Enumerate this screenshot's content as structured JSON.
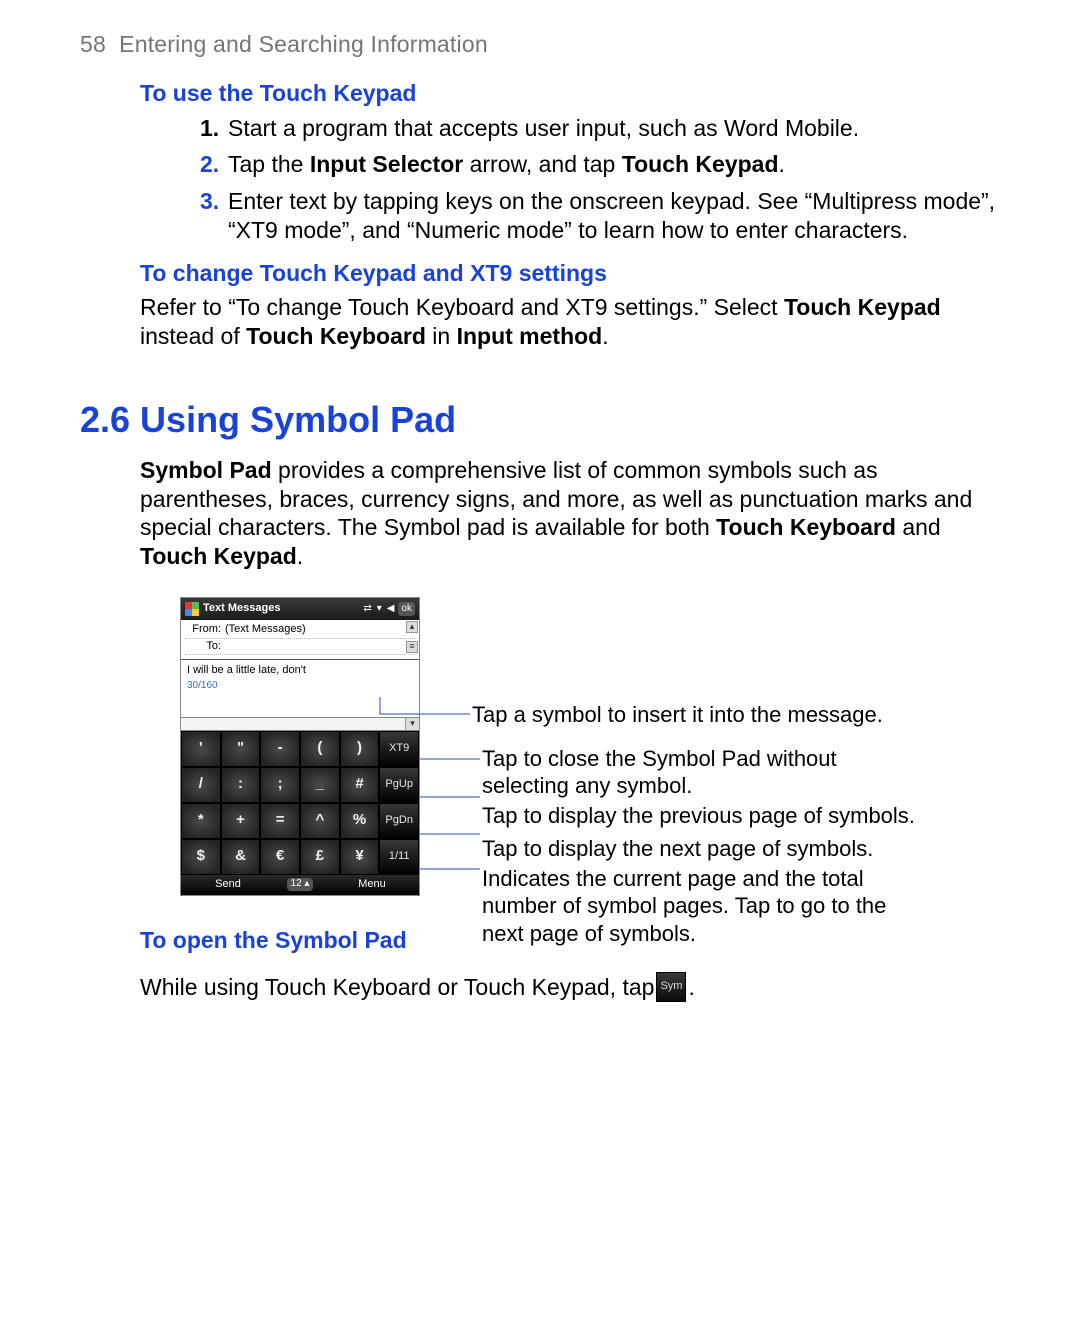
{
  "header": {
    "page_number": "58",
    "chapter_title": "Entering and Searching Information"
  },
  "sections": {
    "use_touch_keypad": {
      "heading": "To use the Touch Keypad",
      "items": [
        {
          "num": "1.",
          "prefix": "",
          "text": "Start a program that accepts user input, such as Word Mobile."
        },
        {
          "num": "2.",
          "prefix": "Tap the ",
          "bold1": "Input Selector",
          "mid": " arrow, and tap ",
          "bold2": "Touch Keypad",
          "suffix": "."
        },
        {
          "num": "3.",
          "text": "Enter text by tapping keys on the onscreen keypad. See “Multipress mode”, “XT9 mode”, and “Numeric mode” to learn how to enter characters."
        }
      ]
    },
    "change_settings": {
      "heading": "To change Touch Keypad and XT9 settings",
      "para_pre": "Refer to “To change Touch Keyboard and XT9 settings.” Select ",
      "bold1": "Touch Keypad",
      "mid": " instead of ",
      "bold2": "Touch Keyboard",
      "mid2": " in ",
      "bold3": "Input method",
      "suffix": "."
    },
    "symbol_pad": {
      "heading": "2.6  Using Symbol Pad",
      "para_bold1": "Symbol Pad",
      "para_text1": " provides a comprehensive list of common symbols such as parentheses, braces, currency signs, and more, as well as punctuation marks and special characters. The Symbol pad is available for both ",
      "para_bold2": "Touch Keyboard",
      "para_mid": " and ",
      "para_bold3": "Touch Keypad",
      "para_suffix": "."
    },
    "open_symbol": {
      "heading": "To open the Symbol Pad",
      "text_pre": "While using Touch Keyboard or Touch Keypad, tap ",
      "text_post": ".",
      "key_label": "Sym"
    }
  },
  "phone_ui": {
    "titlebar": "Text Messages",
    "ok": "ok",
    "from_label": "From:",
    "from_value": "(Text Messages)",
    "to_label": "To:",
    "to_value": "",
    "message_text": "I will be a little late, don't",
    "counter": "30/160",
    "side_keys": [
      "XT9",
      "PgUp",
      "PgDn",
      "1/11"
    ],
    "keypad": [
      [
        "'",
        "\"",
        "-",
        "(",
        ")"
      ],
      [
        "/",
        ":",
        ";",
        "_",
        "#"
      ],
      [
        "*",
        "+",
        "=",
        "^",
        "%"
      ],
      [
        "$",
        "&",
        "€",
        "£",
        "¥"
      ]
    ],
    "softkeys": {
      "left": "Send",
      "mid": "12",
      "right": "Menu"
    }
  },
  "callouts": {
    "c1": "Tap a symbol to insert it into the message.",
    "c2": "Tap to close the Symbol Pad without selecting any symbol.",
    "c3": "Tap to display the previous page of symbols.",
    "c4": "Tap to display the next page of symbols.",
    "c5": "Indicates the current page and the total number of symbol pages. Tap to go to the next page of symbols."
  }
}
